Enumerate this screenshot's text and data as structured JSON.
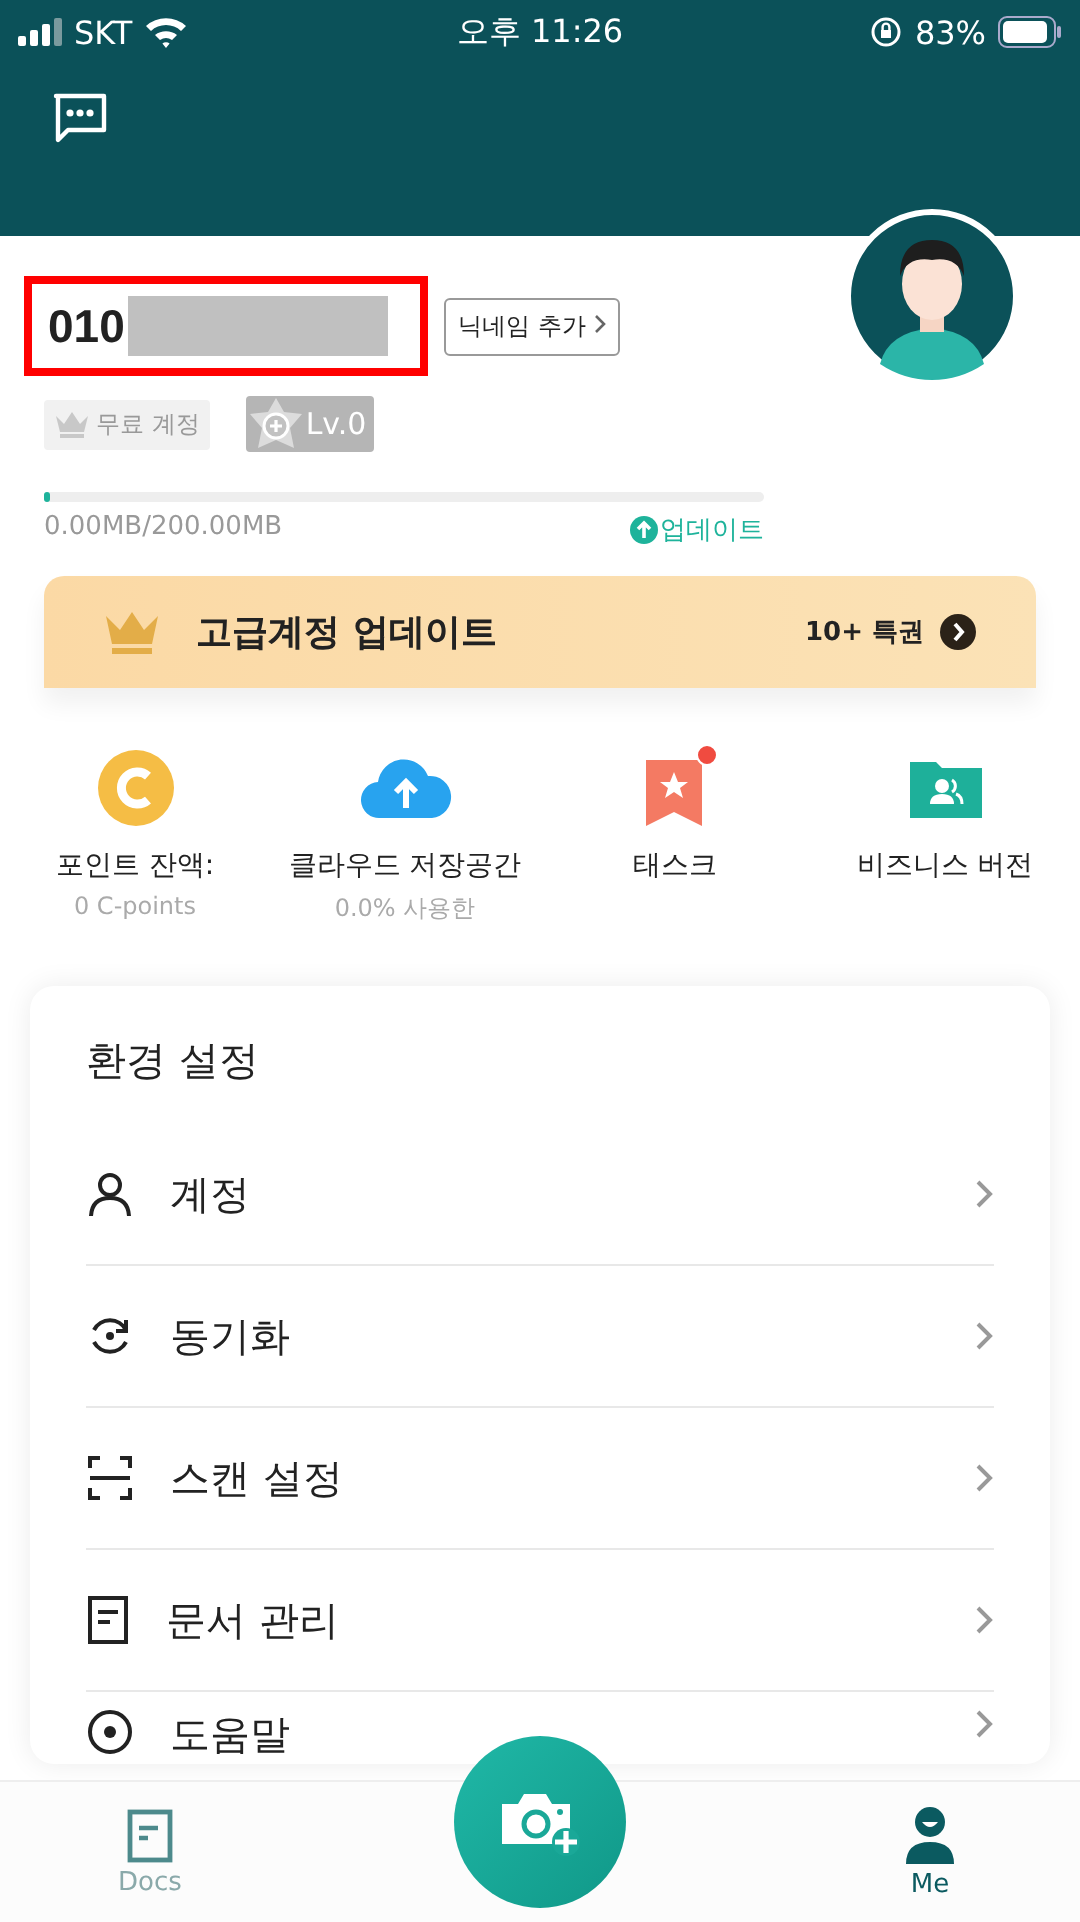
{
  "status_bar": {
    "carrier": "SKT",
    "time": "오후 11:26",
    "battery": "83%"
  },
  "profile": {
    "phone": "010",
    "nickname_button": "닉네임 추가",
    "account_badge": "무료 계정",
    "level_badge": "Lv.0",
    "storage": {
      "level": 0.005,
      "reading": "0.00MB/200.00MB",
      "upgrade_link": "업데이트"
    }
  },
  "premium_banner": {
    "title": "고급계정 업데이트",
    "benefits": "10+ 특권"
  },
  "shortcuts": [
    {
      "kind": "points",
      "label": "포인트 잔액:",
      "sub": "0 C-points",
      "badge": false
    },
    {
      "kind": "cloud",
      "label": "클라우드 저장공간",
      "sub": "0.0% 사용한",
      "badge": false
    },
    {
      "kind": "task",
      "label": "태스크",
      "badge": true
    },
    {
      "kind": "business",
      "label": "비즈니스 버전",
      "badge": false
    }
  ],
  "settings": {
    "title": "환경 설정",
    "items": [
      {
        "kind": "account",
        "label": "계정"
      },
      {
        "kind": "sync",
        "label": "동기화"
      },
      {
        "kind": "scan",
        "label": "스캔 설정"
      },
      {
        "kind": "docs",
        "label": "문서 관리"
      },
      {
        "kind": "help",
        "label": "도움말"
      }
    ]
  },
  "tab_bar": [
    {
      "kind": "docs",
      "label": "Docs",
      "selected": false
    },
    {
      "kind": "me",
      "label": "Me",
      "selected": true
    }
  ]
}
